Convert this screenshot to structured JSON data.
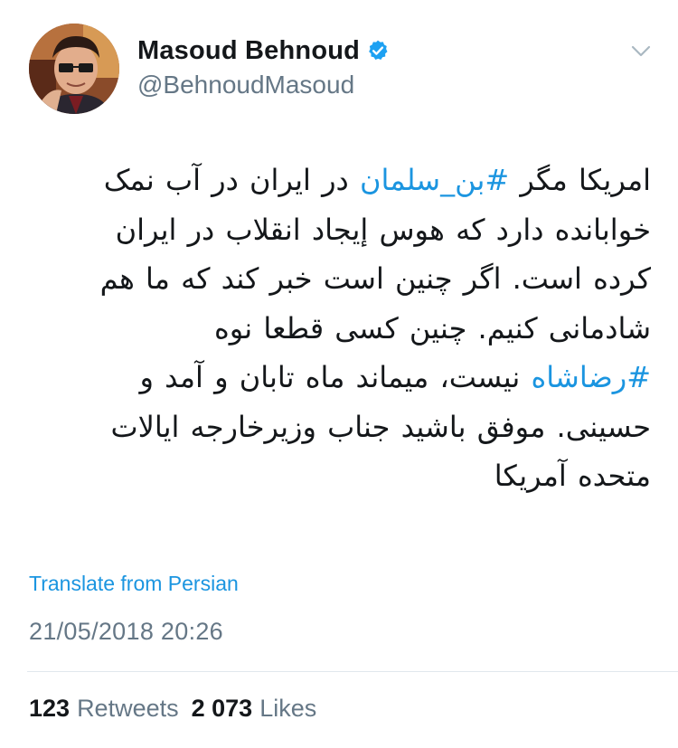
{
  "user": {
    "display_name": "Masoud Behnoud",
    "handle": "@BehnoudMasoud",
    "verified": true,
    "avatar": "profile-photo"
  },
  "menu_icon": "chevron-down-icon",
  "tweet": {
    "lines": [
      {
        "pre": "امریکا مگر ",
        "hashtag": "#بن_سلمان",
        "post": " در ایران در آب نمک"
      },
      {
        "text": "خوابانده دارد که هوس إیجاد انقلاب در ایران"
      },
      {
        "text": "کرده است. اگر چنین است خبر کند که ما هم"
      },
      {
        "text": "شادمانی کنیم. چنین کسی قطعا نوه"
      },
      {
        "pre": "",
        "hashtag": "#رضاشاه",
        "post": " نیست، میماند ماه تابان و آمد و"
      },
      {
        "text": "حسینی. موفق باشید جناب وزیرخارجه ایالات"
      },
      {
        "text": "متحده آمریکا"
      }
    ],
    "translate_label": "Translate from Persian",
    "timestamp": "21/05/2018 20:26"
  },
  "stats": {
    "retweets_count": "123",
    "retweets_label": "Retweets",
    "likes_count": "2 073",
    "likes_label": "Likes"
  },
  "colors": {
    "link": "#1b95e0",
    "secondary": "#657786",
    "text": "#14171a",
    "verified_badge": "#1da1f2"
  }
}
